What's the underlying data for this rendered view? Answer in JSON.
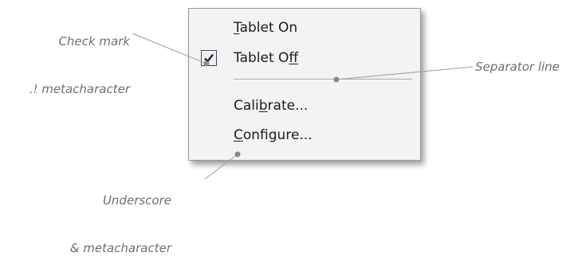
{
  "menu": {
    "items": [
      {
        "pre": "",
        "u": "T",
        "post": "ablet On"
      },
      {
        "pre": "Tablet O",
        "u": "f",
        "post": "f",
        "checked": true
      },
      {
        "pre": "Cali",
        "u": "b",
        "post": "rate..."
      },
      {
        "pre": "",
        "u": "C",
        "post": "onfigure..."
      }
    ]
  },
  "annotations": {
    "check_mark": {
      "line1": "Check mark",
      "line2": ".! metacharacter"
    },
    "separator": "Separator line",
    "underscore": {
      "line1": "Underscore",
      "line2": "& metacharacter"
    }
  },
  "colors": {
    "annotation_text": "#707070",
    "leader_line": "#9a9a9a",
    "menu_bg": "#f3f3f3"
  }
}
